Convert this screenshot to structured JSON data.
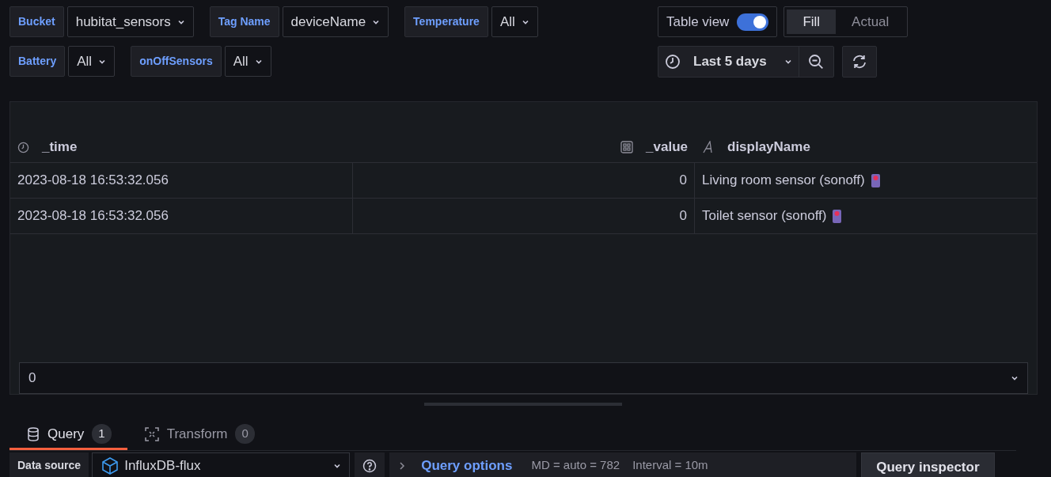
{
  "variable_rows": [
    [
      {
        "label": "Bucket",
        "value": "hubitat_sensors"
      },
      {
        "label": "Tag Name",
        "value": "deviceName"
      },
      {
        "label": "Temperature",
        "value": "All"
      }
    ],
    [
      {
        "label": "Battery",
        "value": "All"
      },
      {
        "label": "onOffSensors",
        "value": "All"
      }
    ]
  ],
  "table_view": {
    "label": "Table view",
    "on": true
  },
  "fill_toggle": [
    {
      "label": "Fill",
      "selected": true
    },
    {
      "label": "Actual",
      "selected": false
    }
  ],
  "time_range": {
    "value": "Last 5 days"
  },
  "table": {
    "columns": [
      {
        "name": "_time",
        "kind": "time"
      },
      {
        "name": "_value",
        "kind": "number"
      },
      {
        "name": "displayName",
        "kind": "string"
      }
    ],
    "rows": [
      [
        "2023-08-18 16:53:32.056",
        "0",
        "Living room sensor (sonoff)"
      ],
      [
        "2023-08-18 16:53:32.056",
        "0",
        "Toilet sensor (sonoff)"
      ]
    ],
    "footer_value": "0"
  },
  "tabs": [
    {
      "label": "Query",
      "count": "1",
      "kind": "query",
      "selected": true
    },
    {
      "label": "Transform",
      "count": "0",
      "kind": "transform",
      "selected": false
    }
  ],
  "query_row": {
    "data_source_label": "Data source",
    "data_source": "InfluxDB-flux",
    "options_label": "Query options",
    "md": "MD = auto = 782",
    "interval": "Interval = 10m",
    "inspector": "Query inspector"
  }
}
